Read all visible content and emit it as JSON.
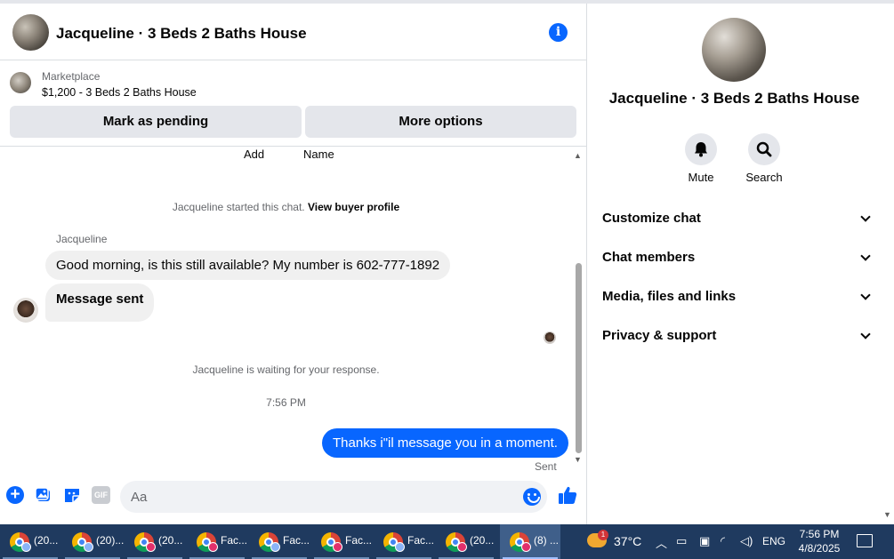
{
  "chat": {
    "title": "Jacqueline · 3 Beds 2 Baths House",
    "marketplace_label": "Marketplace",
    "listing": "$1,200 - 3 Beds 2 Baths House",
    "mark_pending_label": "Mark as pending",
    "more_options_label": "More options"
  },
  "messages": {
    "truncated_left": "Add",
    "truncated_right": "Name",
    "started_text": "Jacqueline started this chat.",
    "view_profile_link": "View buyer profile",
    "sender_name": "Jacqueline",
    "incoming": [
      "Good morning, is this still available? My number is 602-777-1892",
      "Message sent"
    ],
    "waiting_text": "Jacqueline is waiting for your response.",
    "timestamp": "7:56 PM",
    "outgoing": "Thanks i\"il message you in a moment.",
    "sent_status": "Sent"
  },
  "composer": {
    "placeholder": "Aa",
    "gif_label": "GIF"
  },
  "info_panel": {
    "title": "Jacqueline · 3 Beds 2 Baths House",
    "mute_label": "Mute",
    "search_label": "Search",
    "sections": [
      "Customize chat",
      "Chat members",
      "Media, files and links",
      "Privacy & support"
    ]
  },
  "taskbar": {
    "tasks": [
      "(20...",
      "(20)...",
      "(20...",
      "Fac...",
      "Fac...",
      "Fac...",
      "Fac...",
      "(20...",
      "(8) ..."
    ],
    "weather_badge": "1",
    "temperature": "37°C",
    "language": "ENG",
    "time": "7:56 PM",
    "date": "4/8/2025"
  },
  "colors": {
    "accent": "#0866ff",
    "bubble_in": "#f0f0f0",
    "button_bg": "#e4e6eb",
    "taskbar": "#1f3a5f"
  }
}
